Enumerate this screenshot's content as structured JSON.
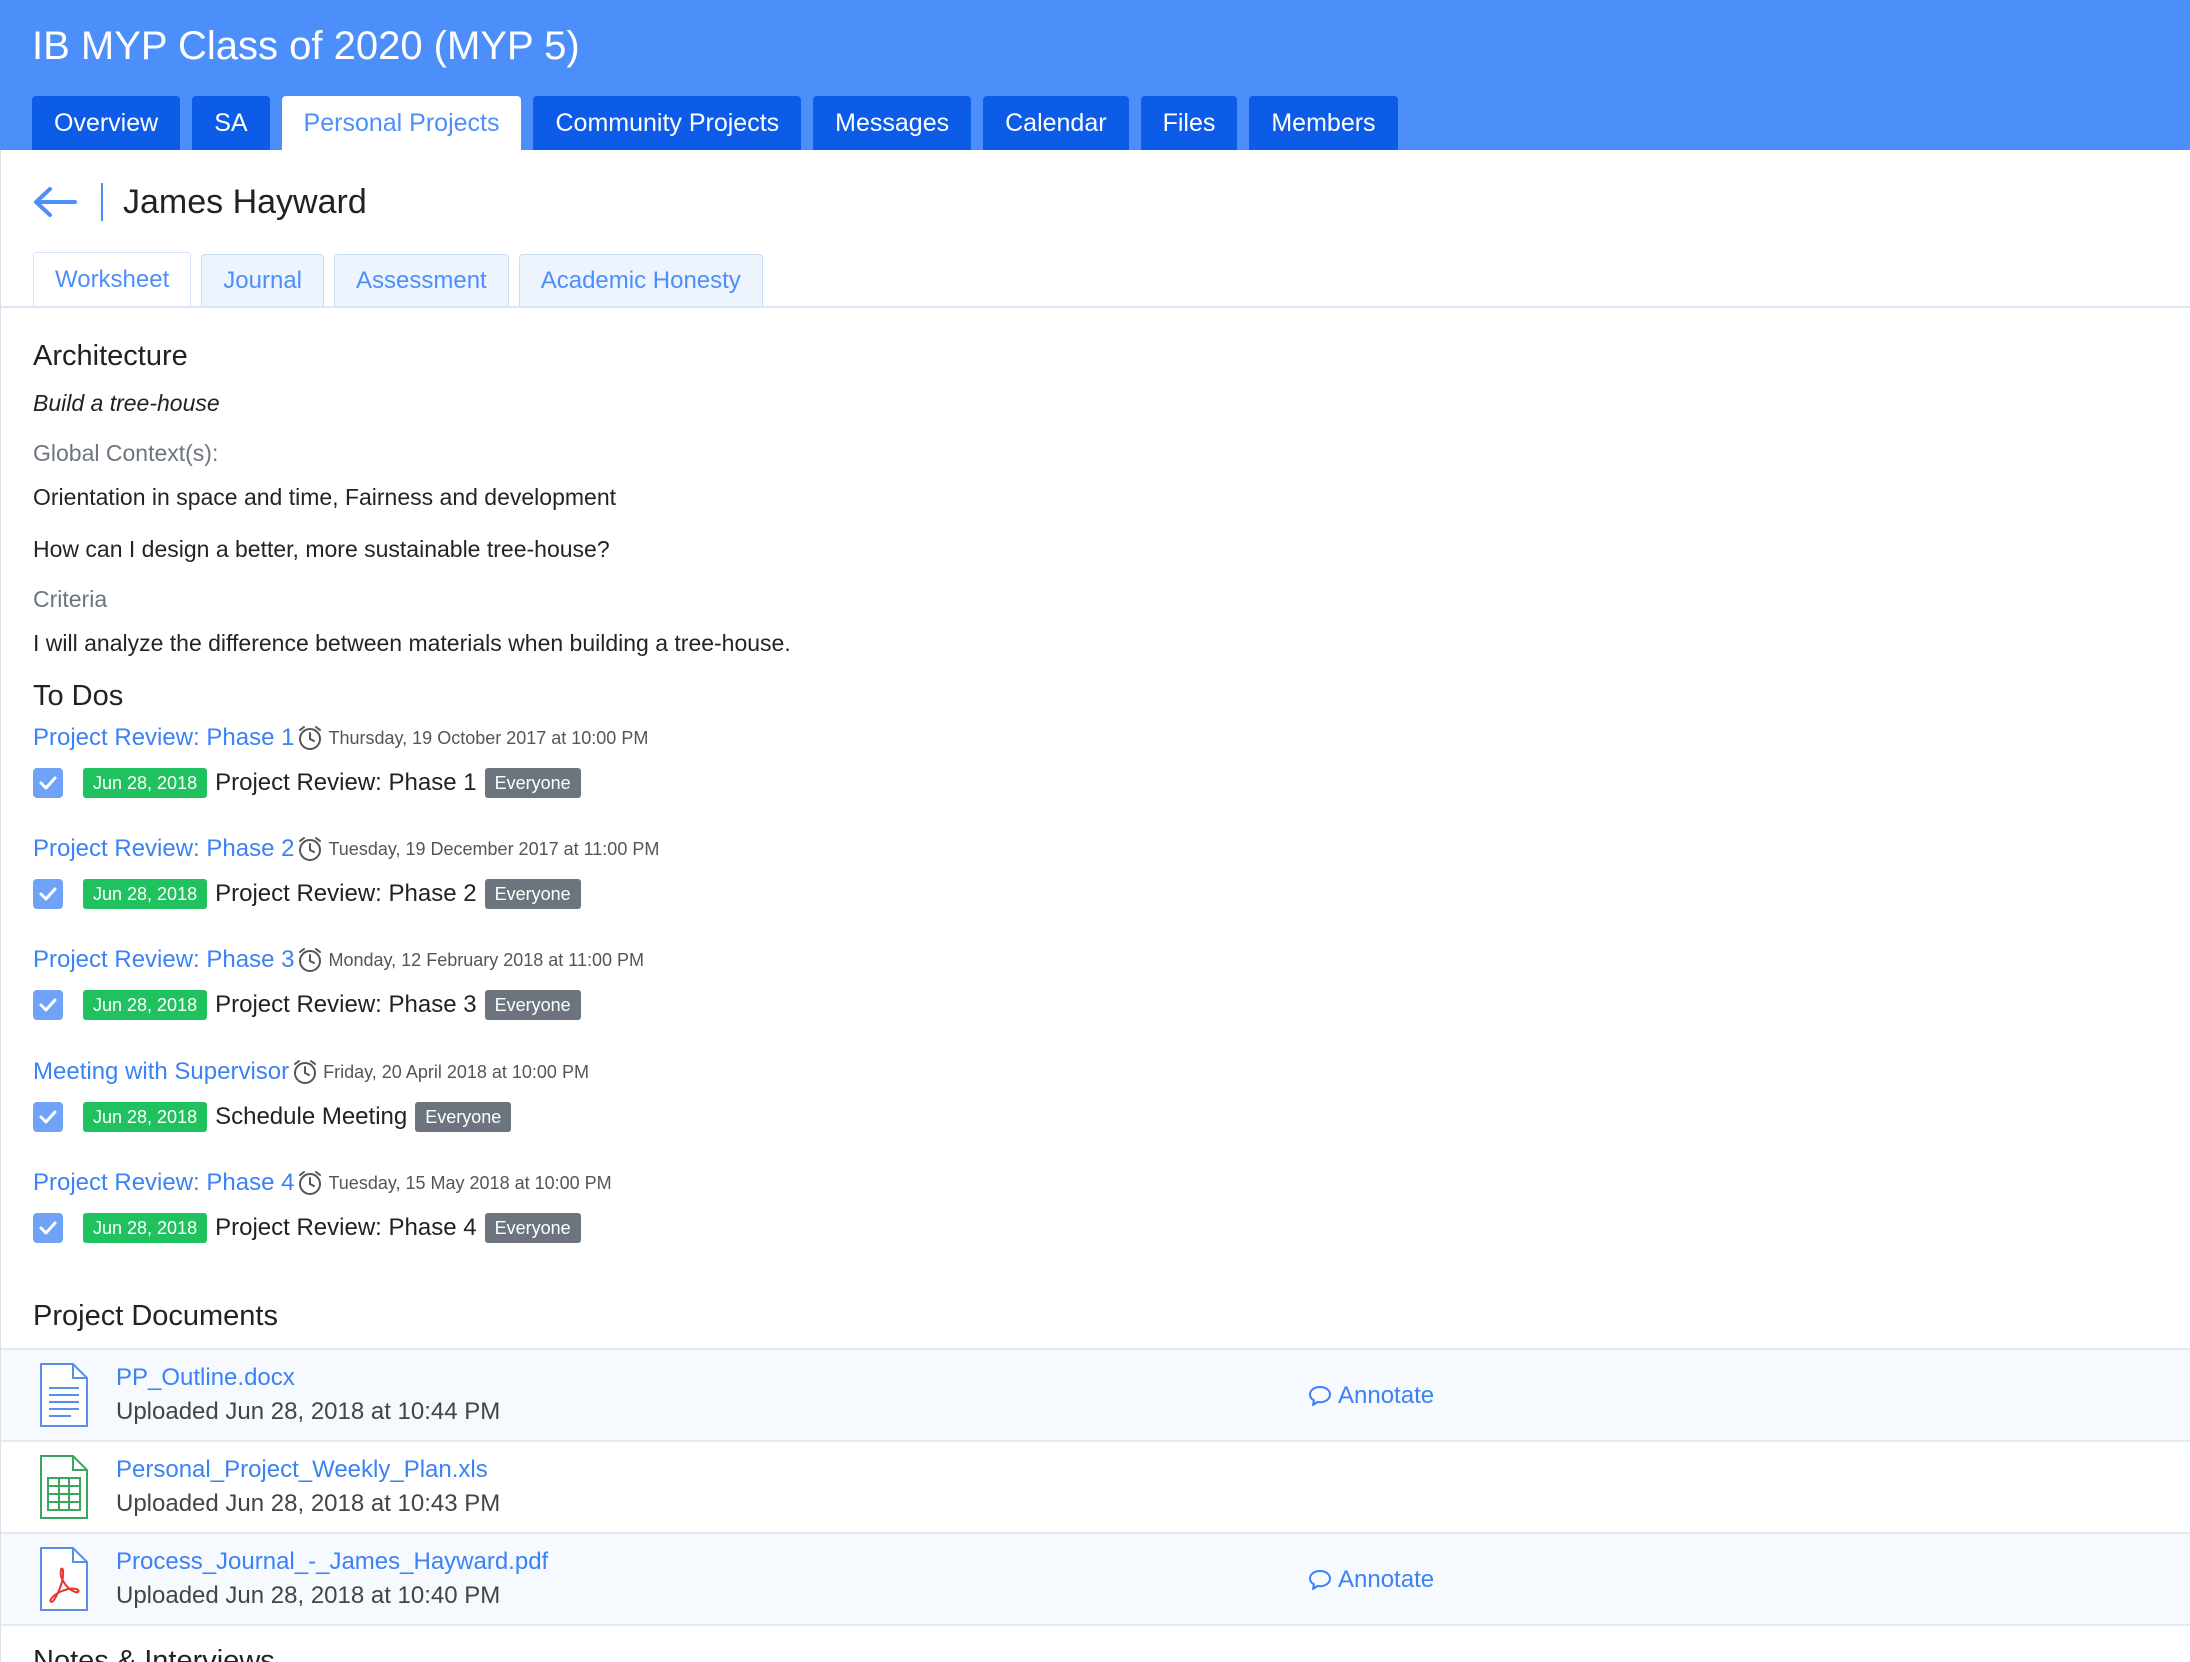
{
  "header": {
    "class_title": "IB MYP Class of 2020 (MYP 5)",
    "tabs": [
      {
        "label": "Overview"
      },
      {
        "label": "SA"
      },
      {
        "label": "Personal Projects"
      },
      {
        "label": "Community Projects"
      },
      {
        "label": "Messages"
      },
      {
        "label": "Calendar"
      },
      {
        "label": "Files"
      },
      {
        "label": "Members"
      }
    ],
    "active_tab": "Personal Projects"
  },
  "student": {
    "back_icon": "arrow-left-icon",
    "name": "James Hayward"
  },
  "sub_tabs": [
    {
      "label": "Worksheet"
    },
    {
      "label": "Journal"
    },
    {
      "label": "Assessment"
    },
    {
      "label": "Academic Honesty"
    }
  ],
  "active_sub_tab": "Worksheet",
  "worksheet": {
    "area": "Architecture",
    "goal": "Build a tree-house",
    "global_context_label": "Global Context(s):",
    "global_context": "Orientation in space and time, Fairness and development",
    "question": "How can I design a better, more sustainable tree-house?",
    "criteria_label": "Criteria",
    "criteria": "I will analyze the difference between materials when building a tree-house."
  },
  "todos": {
    "heading": "To Dos",
    "items": [
      {
        "title": "Project Review: Phase 1",
        "due": "Thursday, 19 October 2017 at 10:00 PM",
        "completed_date": "Jun 28, 2018",
        "name": "Project Review: Phase 1",
        "audience": "Everyone",
        "checked": true
      },
      {
        "title": "Project Review: Phase 2",
        "due": "Tuesday, 19 December 2017 at 11:00 PM",
        "completed_date": "Jun 28, 2018",
        "name": "Project Review: Phase 2",
        "audience": "Everyone",
        "checked": true
      },
      {
        "title": "Project Review: Phase 3",
        "due": "Monday, 12 February 2018 at 11:00 PM",
        "completed_date": "Jun 28, 2018",
        "name": "Project Review: Phase 3",
        "audience": "Everyone",
        "checked": true
      },
      {
        "title": "Meeting with Supervisor",
        "due": "Friday, 20 April 2018 at 10:00 PM",
        "completed_date": "Jun 28, 2018",
        "name": "Schedule Meeting",
        "audience": "Everyone",
        "checked": true
      },
      {
        "title": "Project Review: Phase 4",
        "due": "Tuesday, 15 May 2018 at 10:00 PM",
        "completed_date": "Jun 28, 2018",
        "name": "Project Review: Phase 4",
        "audience": "Everyone",
        "checked": true
      }
    ]
  },
  "documents": {
    "heading": "Project Documents",
    "annotate_label": "Annotate",
    "items": [
      {
        "name": "PP_Outline.docx",
        "uploaded": "Uploaded Jun 28, 2018 at 10:44 PM",
        "icon": "word-document-icon",
        "annotatable": true
      },
      {
        "name": "Personal_Project_Weekly_Plan.xls",
        "uploaded": "Uploaded Jun 28, 2018 at 10:43 PM",
        "icon": "spreadsheet-icon",
        "annotatable": false
      },
      {
        "name": "Process_Journal_-_James_Hayward.pdf",
        "uploaded": "Uploaded Jun 28, 2018 at 10:40 PM",
        "icon": "pdf-icon",
        "annotatable": true
      }
    ]
  },
  "notes": {
    "heading": "Notes & Interviews"
  },
  "colors": {
    "header_bg": "#4c8ffb",
    "tab_bg": "#0d5ce8",
    "link": "#3b82f6",
    "date_badge": "#20c15f",
    "audience_badge": "#6c757d",
    "checkbox": "#6fa3f7"
  }
}
